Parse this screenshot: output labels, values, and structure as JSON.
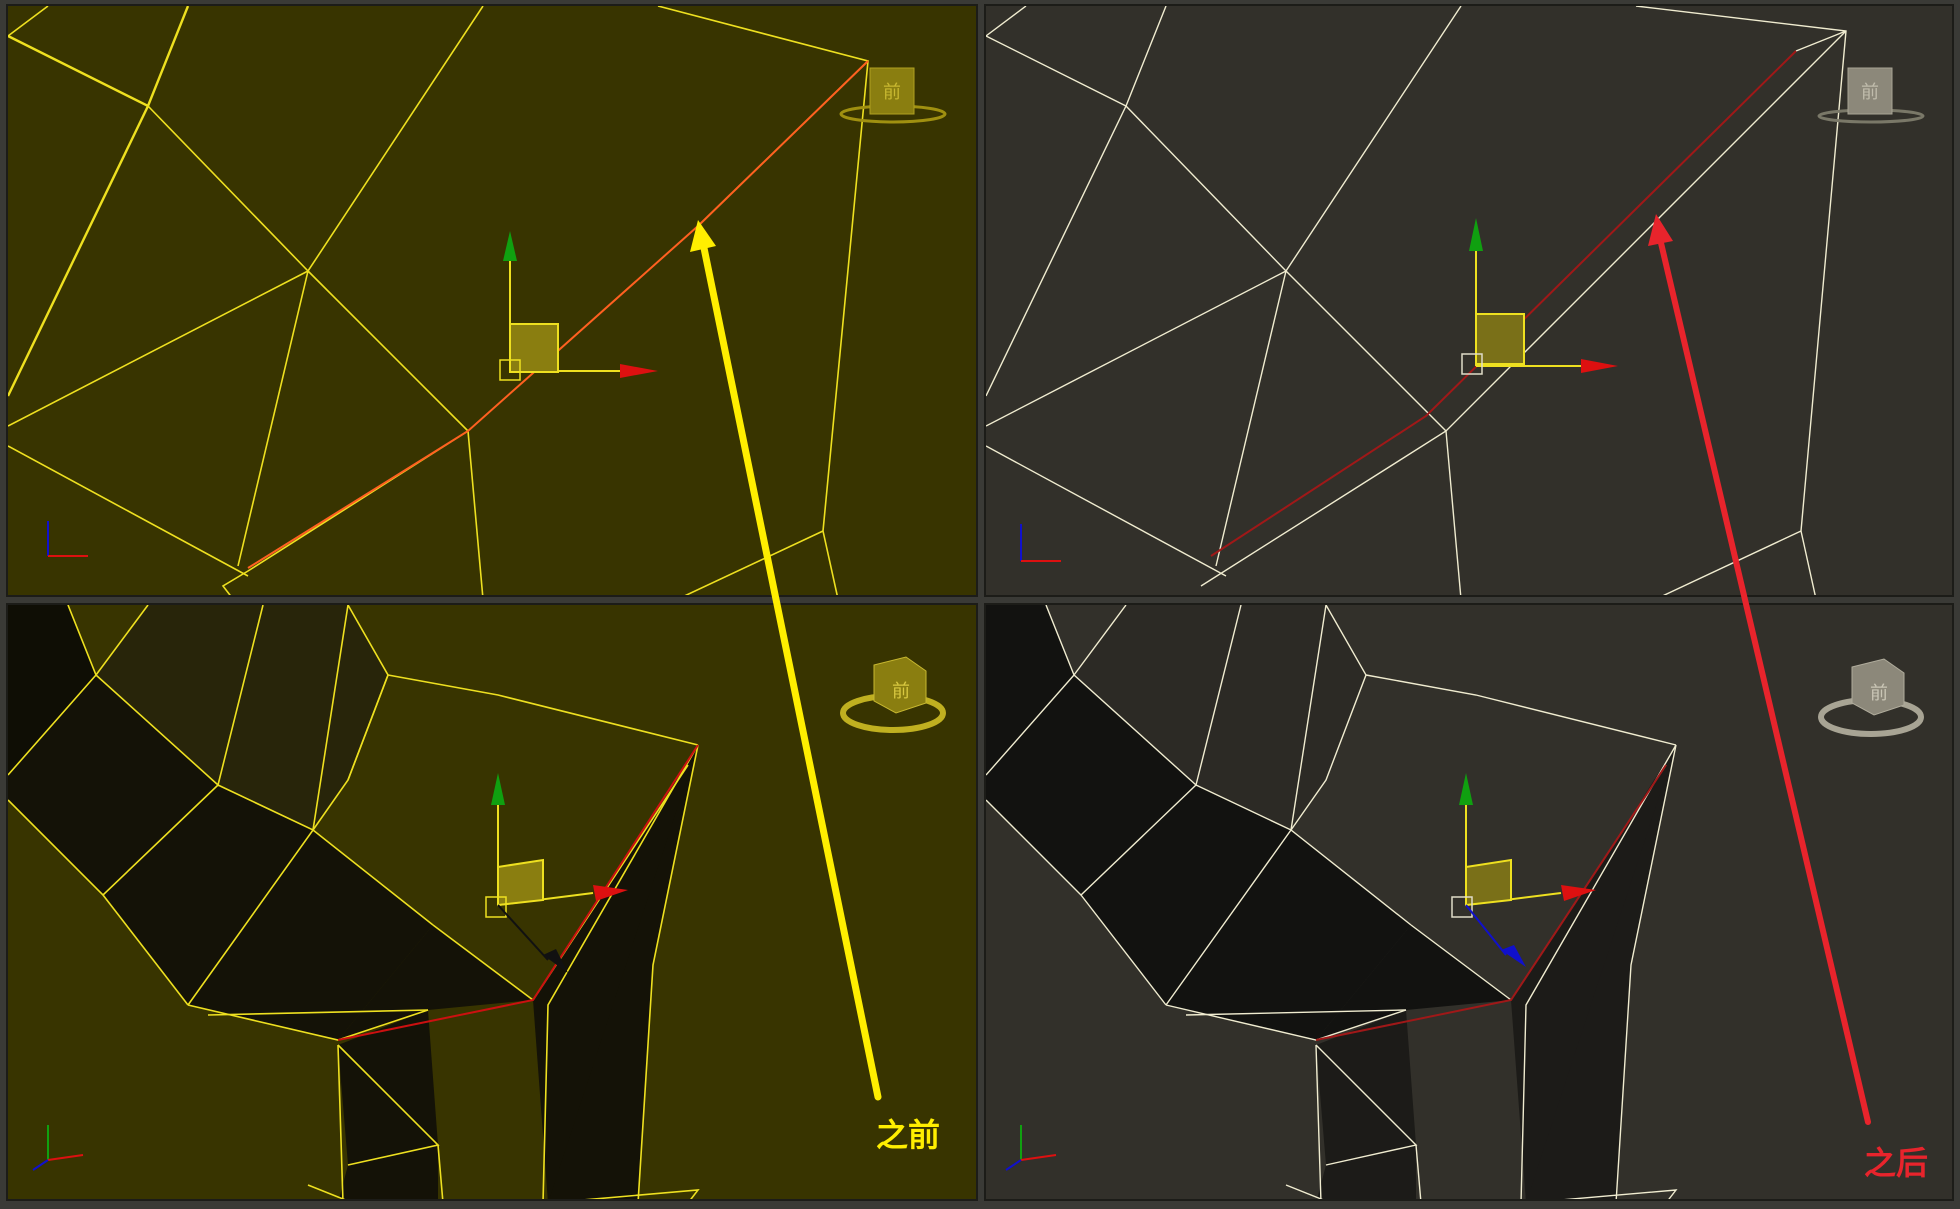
{
  "annotations": {
    "before": "之前",
    "after": "之后"
  },
  "viewports": [
    {
      "id": "top-left",
      "state": "before",
      "highlight_color": "#ff6020"
    },
    {
      "id": "bottom-left",
      "state": "before",
      "highlight_color": "#cc1010"
    },
    {
      "id": "top-right",
      "state": "after",
      "highlight_color": "#a01818"
    },
    {
      "id": "bottom-right",
      "state": "after",
      "highlight_color": "#a01818"
    }
  ],
  "colors": {
    "before_bg": "#383400",
    "before_wire": "#ffee22",
    "after_bg": "#32302a",
    "after_wire": "#ffffdc",
    "arrow_before": "#ffee00",
    "arrow_after": "#e8242c",
    "gizmo_x": "#dd1010",
    "gizmo_y": "#10a010",
    "gizmo_z": "#1010cc"
  },
  "icons": [
    "view-cube-icon",
    "transform-gizmo-icon",
    "axis-tripod-icon"
  ]
}
